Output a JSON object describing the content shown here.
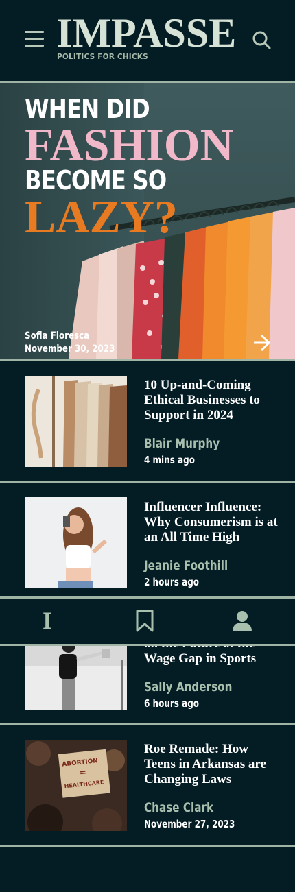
{
  "header": {
    "logo": "IMPASSE",
    "tagline": "POLITICS FOR CHICKS",
    "menu_icon": "hamburger-menu-icon",
    "search_icon": "search-icon"
  },
  "hero": {
    "title_line1": "WHEN DID",
    "title_line2": "FASHION",
    "title_line3": "BECOME SO",
    "title_line4": "LAZY?",
    "author": "Sofia Floresca",
    "date": "November 30, 2023",
    "arrow_icon": "arrow-right-icon"
  },
  "articles": [
    {
      "title": "10 Up-and-Coming Ethical Businesses to Support in 2024",
      "author": "Blair Murphy",
      "time": "4 mins ago"
    },
    {
      "title": "Influencer Influence: Why Consumerism is at an All Time High",
      "author": "Jeanie Foothill",
      "time": "2 hours ago"
    },
    {
      "title": "on the Future of the Wage Gap in Sports",
      "author": "Sally Anderson",
      "time": "6 hours ago"
    },
    {
      "title": "Roe Remade: How Teens in Arkansas are Changing Laws",
      "author": "Chase Clark",
      "time": "November 27, 2023"
    }
  ],
  "sign_text": [
    "ABORTION",
    "=",
    "HEALTHCARE"
  ],
  "nav": {
    "home_glyph": "I",
    "items": [
      "home-icon",
      "bookmark-icon",
      "profile-icon"
    ]
  },
  "colors": {
    "background": "#041c24",
    "accent_sage": "#a0b4a6",
    "pink": "#f0b8c8",
    "orange": "#e87a22"
  }
}
